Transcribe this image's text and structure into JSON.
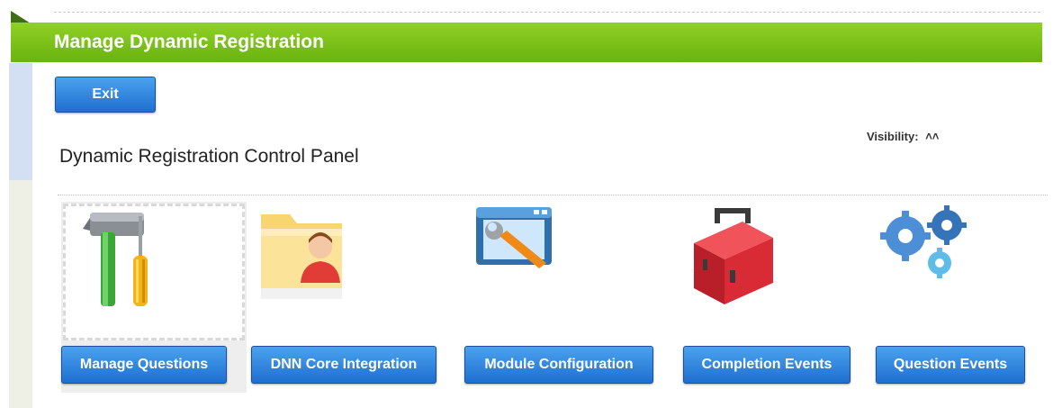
{
  "header": {
    "title": "Manage Dynamic Registration"
  },
  "toolbar": {
    "exit_label": "Exit"
  },
  "visibility": {
    "label": "Visibility:",
    "icon": "double-chevron-up-icon"
  },
  "panel": {
    "title": "Dynamic Registration Control Panel"
  },
  "actions": [
    {
      "label": "Manage Questions",
      "icon": "tools-icon",
      "selected": true
    },
    {
      "label": "DNN Core Integration",
      "icon": "user-folder-icon",
      "selected": false
    },
    {
      "label": "Module Configuration",
      "icon": "wrench-window-icon",
      "selected": false
    },
    {
      "label": "Completion Events",
      "icon": "toolbox-icon",
      "selected": false
    },
    {
      "label": "Question Events",
      "icon": "gears-icon",
      "selected": false
    }
  ],
  "colors": {
    "header_green": "#7cc11c",
    "button_blue": "#2b7fd9"
  }
}
